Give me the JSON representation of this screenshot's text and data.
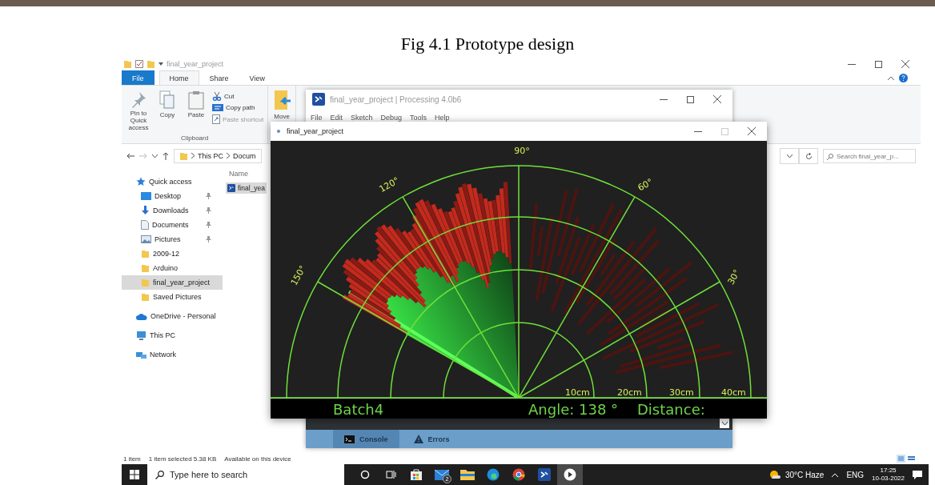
{
  "caption": "Fig 4.1 Prototype design",
  "explorer": {
    "title": "final_year_project",
    "ribbon_tabs": [
      {
        "label": "File",
        "kind": "file",
        "selected": false
      },
      {
        "label": "Home",
        "kind": "tab",
        "selected": true
      },
      {
        "label": "Share",
        "kind": "tab",
        "selected": false
      },
      {
        "label": "View",
        "kind": "tab",
        "selected": false
      }
    ],
    "clipboard": {
      "buttons": [
        {
          "label": "Pin to Quick access",
          "kind": "pin"
        },
        {
          "label": "Copy",
          "kind": "copy"
        },
        {
          "label": "Paste",
          "kind": "paste"
        }
      ],
      "small_buttons": [
        {
          "label": "Cut",
          "kind": "cut",
          "disabled": false
        },
        {
          "label": "Copy path",
          "kind": "path",
          "disabled": false
        },
        {
          "label": "Paste shortcut",
          "kind": "shortcut",
          "disabled": true
        }
      ],
      "group_label": "Clipboard"
    },
    "move_button": "Move",
    "breadcrumb": [
      "This PC",
      "Docum"
    ],
    "search": {
      "placeholder": "Search final_year_p..."
    },
    "nav": [
      {
        "label": "Quick access",
        "kind": "star",
        "pinned": false,
        "selected": false,
        "children": [
          {
            "label": "Desktop",
            "kind": "desktop",
            "pinned": true,
            "selected": false
          },
          {
            "label": "Downloads",
            "kind": "download",
            "pinned": true,
            "selected": false
          },
          {
            "label": "Documents",
            "kind": "document",
            "pinned": true,
            "selected": false
          },
          {
            "label": "Pictures",
            "kind": "picture",
            "pinned": true,
            "selected": false
          },
          {
            "label": "2009-12",
            "kind": "folder",
            "pinned": false,
            "selected": false
          },
          {
            "label": "Arduino",
            "kind": "folder",
            "pinned": false,
            "selected": false
          },
          {
            "label": "final_year_project",
            "kind": "folder",
            "pinned": false,
            "selected": true
          },
          {
            "label": "Saved Pictures",
            "kind": "folder",
            "pinned": false,
            "selected": false
          }
        ]
      },
      {
        "label": "OneDrive - Personal",
        "kind": "cloud",
        "pinned": false,
        "selected": false
      },
      {
        "label": "This PC",
        "kind": "pc",
        "pinned": false,
        "selected": false
      },
      {
        "label": "Network",
        "kind": "network",
        "pinned": false,
        "selected": false
      }
    ],
    "column": "Name",
    "files": [
      {
        "name": "final_yea",
        "selected": true
      }
    ],
    "status": [
      "1 item",
      "1 item selected  5.38 KB",
      "Available on this device"
    ]
  },
  "ide": {
    "title": "final_year_project | Processing 4.0b6",
    "menu": [
      "File",
      "Edit",
      "Sketch",
      "Debug",
      "Tools",
      "Help"
    ],
    "console_tabs": [
      {
        "label": "Console",
        "kind": "console",
        "selected": true
      },
      {
        "label": "Errors",
        "kind": "errors",
        "selected": false
      }
    ]
  },
  "sketch": {
    "title": "final_year_project",
    "angle_labels": [
      "30°",
      "60°",
      "90°",
      "120°",
      "150°"
    ],
    "distance_labels": [
      "10cm",
      "20cm",
      "30cm",
      "40cm"
    ],
    "project_label": "Batch4",
    "angle_readout": "Angle: 138 °",
    "distance_readout": "Distance:"
  },
  "taskbar": {
    "search": {
      "placeholder": "Type here to search"
    },
    "apps": [
      {
        "kind": "cortana",
        "selected": false
      },
      {
        "kind": "taskview",
        "selected": false
      },
      {
        "kind": "store",
        "selected": false
      },
      {
        "kind": "mail",
        "badge": "2",
        "selected": false
      },
      {
        "kind": "explorer",
        "selected": false
      },
      {
        "kind": "edge",
        "selected": false
      },
      {
        "kind": "chrome",
        "selected": false
      },
      {
        "kind": "processing",
        "selected": false
      },
      {
        "kind": "media",
        "selected": true
      }
    ],
    "weather": "30°C Haze",
    "language": "ENG",
    "time": "17:25",
    "date": "10-03-2022"
  }
}
